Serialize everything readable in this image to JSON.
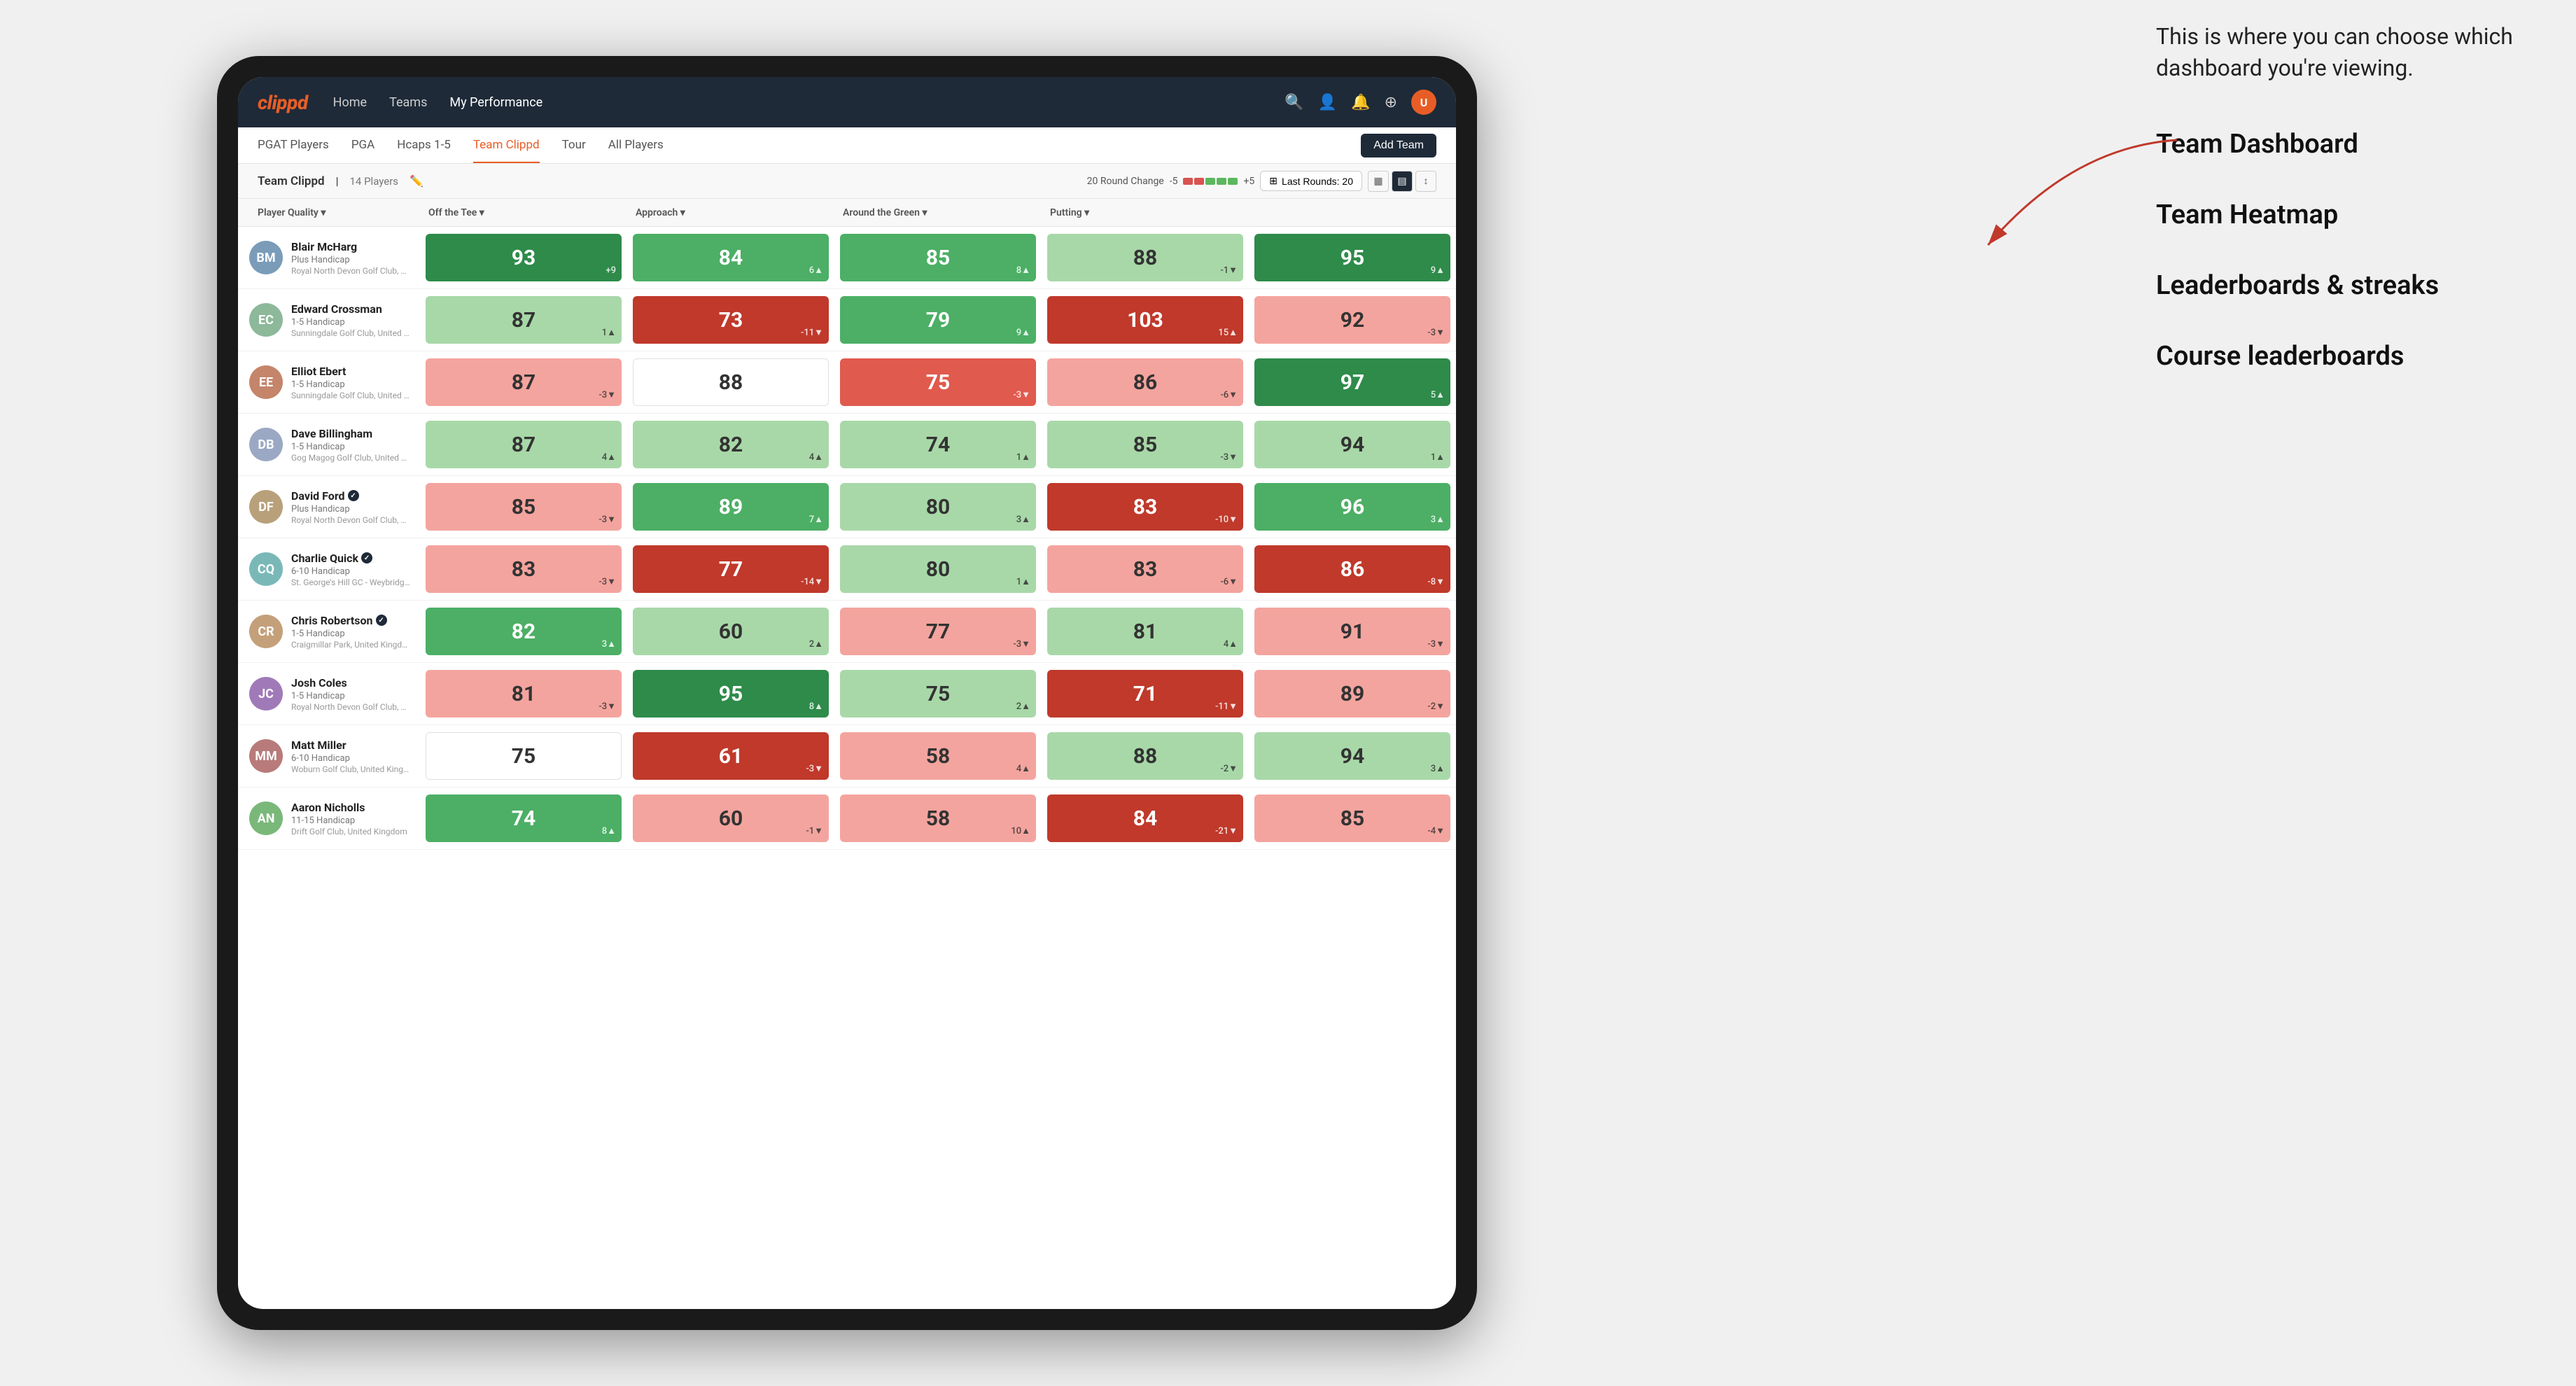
{
  "annotation": {
    "description": "This is where you can choose which dashboard you're viewing.",
    "labels": [
      "Team Dashboard",
      "Team Heatmap",
      "Leaderboards & streaks",
      "Course leaderboards"
    ]
  },
  "navbar": {
    "logo": "clippd",
    "links": [
      {
        "label": "Home",
        "active": false
      },
      {
        "label": "Teams",
        "active": false
      },
      {
        "label": "My Performance",
        "active": true
      }
    ],
    "icons": [
      "🔍",
      "👤",
      "🔔",
      "⊕"
    ]
  },
  "subnav": {
    "tabs": [
      {
        "label": "PGAT Players",
        "active": false
      },
      {
        "label": "PGA",
        "active": false
      },
      {
        "label": "Hcaps 1-5",
        "active": false
      },
      {
        "label": "Team Clippd",
        "active": true
      },
      {
        "label": "Tour",
        "active": false
      },
      {
        "label": "All Players",
        "active": false
      }
    ],
    "add_team_label": "Add Team"
  },
  "team_header": {
    "name": "Team Clippd",
    "separator": "|",
    "player_count": "14 Players",
    "round_change_label": "20 Round Change",
    "round_change_min": "-5",
    "round_change_max": "+5",
    "last_rounds_label": "Last Rounds:",
    "last_rounds_value": "20"
  },
  "table": {
    "columns": [
      {
        "label": "Player Quality ▾",
        "key": "player_quality"
      },
      {
        "label": "Off the Tee ▾",
        "key": "off_the_tee"
      },
      {
        "label": "Approach ▾",
        "key": "approach"
      },
      {
        "label": "Around the Green ▾",
        "key": "around_the_green"
      },
      {
        "label": "Putting ▾",
        "key": "putting"
      }
    ],
    "players": [
      {
        "name": "Blair McHarg",
        "handicap": "Plus Handicap",
        "club": "Royal North Devon Golf Club, United Kingdom",
        "avatar_initials": "BM",
        "avatar_color": "#7a9cb8",
        "verified": false,
        "scores": [
          {
            "value": 93,
            "delta": "+9",
            "trend": "up",
            "color": "green-strong"
          },
          {
            "value": 84,
            "delta": "6▲",
            "trend": "up",
            "color": "green-mid"
          },
          {
            "value": 85,
            "delta": "8▲",
            "trend": "up",
            "color": "green-mid"
          },
          {
            "value": 88,
            "delta": "-1▼",
            "trend": "down",
            "color": "green-light"
          },
          {
            "value": 95,
            "delta": "9▲",
            "trend": "up",
            "color": "green-strong"
          }
        ]
      },
      {
        "name": "Edward Crossman",
        "handicap": "1-5 Handicap",
        "club": "Sunningdale Golf Club, United Kingdom",
        "avatar_initials": "EC",
        "avatar_color": "#8db89a",
        "verified": false,
        "scores": [
          {
            "value": 87,
            "delta": "1▲",
            "trend": "up",
            "color": "green-light"
          },
          {
            "value": 73,
            "delta": "-11▼",
            "trend": "down",
            "color": "red-strong"
          },
          {
            "value": 79,
            "delta": "9▲",
            "trend": "up",
            "color": "green-mid"
          },
          {
            "value": 103,
            "delta": "15▲",
            "trend": "up",
            "color": "red-strong"
          },
          {
            "value": 92,
            "delta": "-3▼",
            "trend": "down",
            "color": "red-light"
          }
        ]
      },
      {
        "name": "Elliot Ebert",
        "handicap": "1-5 Handicap",
        "club": "Sunningdale Golf Club, United Kingdom",
        "avatar_initials": "EE",
        "avatar_color": "#c4856a",
        "verified": false,
        "scores": [
          {
            "value": 87,
            "delta": "-3▼",
            "trend": "down",
            "color": "red-light"
          },
          {
            "value": 88,
            "delta": "",
            "trend": "neutral",
            "color": "white"
          },
          {
            "value": 75,
            "delta": "-3▼",
            "trend": "down",
            "color": "red-mid"
          },
          {
            "value": 86,
            "delta": "-6▼",
            "trend": "down",
            "color": "red-light"
          },
          {
            "value": 97,
            "delta": "5▲",
            "trend": "up",
            "color": "green-strong"
          }
        ]
      },
      {
        "name": "Dave Billingham",
        "handicap": "1-5 Handicap",
        "club": "Gog Magog Golf Club, United Kingdom",
        "avatar_initials": "DB",
        "avatar_color": "#9ba8c4",
        "verified": false,
        "scores": [
          {
            "value": 87,
            "delta": "4▲",
            "trend": "up",
            "color": "green-light"
          },
          {
            "value": 82,
            "delta": "4▲",
            "trend": "up",
            "color": "green-light"
          },
          {
            "value": 74,
            "delta": "1▲",
            "trend": "up",
            "color": "green-light"
          },
          {
            "value": 85,
            "delta": "-3▼",
            "trend": "down",
            "color": "green-light"
          },
          {
            "value": 94,
            "delta": "1▲",
            "trend": "up",
            "color": "green-light"
          }
        ]
      },
      {
        "name": "David Ford",
        "handicap": "Plus Handicap",
        "club": "Royal North Devon Golf Club, United Kingdom",
        "avatar_initials": "DF",
        "avatar_color": "#b8a07a",
        "verified": true,
        "scores": [
          {
            "value": 85,
            "delta": "-3▼",
            "trend": "down",
            "color": "red-light"
          },
          {
            "value": 89,
            "delta": "7▲",
            "trend": "up",
            "color": "green-mid"
          },
          {
            "value": 80,
            "delta": "3▲",
            "trend": "up",
            "color": "green-light"
          },
          {
            "value": 83,
            "delta": "-10▼",
            "trend": "down",
            "color": "red-strong"
          },
          {
            "value": 96,
            "delta": "3▲",
            "trend": "up",
            "color": "green-mid"
          }
        ]
      },
      {
        "name": "Charlie Quick",
        "handicap": "6-10 Handicap",
        "club": "St. George's Hill GC - Weybridge - Surrey, Uni...",
        "avatar_initials": "CQ",
        "avatar_color": "#7ab8b8",
        "verified": true,
        "scores": [
          {
            "value": 83,
            "delta": "-3▼",
            "trend": "down",
            "color": "red-light"
          },
          {
            "value": 77,
            "delta": "-14▼",
            "trend": "down",
            "color": "red-strong"
          },
          {
            "value": 80,
            "delta": "1▲",
            "trend": "up",
            "color": "green-light"
          },
          {
            "value": 83,
            "delta": "-6▼",
            "trend": "down",
            "color": "red-light"
          },
          {
            "value": 86,
            "delta": "-8▼",
            "trend": "down",
            "color": "red-strong"
          }
        ]
      },
      {
        "name": "Chris Robertson",
        "handicap": "1-5 Handicap",
        "club": "Craigmillar Park, United Kingdom",
        "avatar_initials": "CR",
        "avatar_color": "#c4a07a",
        "verified": true,
        "scores": [
          {
            "value": 82,
            "delta": "3▲",
            "trend": "up",
            "color": "green-mid"
          },
          {
            "value": 60,
            "delta": "2▲",
            "trend": "up",
            "color": "green-light"
          },
          {
            "value": 77,
            "delta": "-3▼",
            "trend": "down",
            "color": "red-light"
          },
          {
            "value": 81,
            "delta": "4▲",
            "trend": "up",
            "color": "green-light"
          },
          {
            "value": 91,
            "delta": "-3▼",
            "trend": "down",
            "color": "red-light"
          }
        ]
      },
      {
        "name": "Josh Coles",
        "handicap": "1-5 Handicap",
        "club": "Royal North Devon Golf Club, United Kingdom",
        "avatar_initials": "JC",
        "avatar_color": "#a07ab8",
        "verified": false,
        "scores": [
          {
            "value": 81,
            "delta": "-3▼",
            "trend": "down",
            "color": "red-light"
          },
          {
            "value": 95,
            "delta": "8▲",
            "trend": "up",
            "color": "green-strong"
          },
          {
            "value": 75,
            "delta": "2▲",
            "trend": "up",
            "color": "green-light"
          },
          {
            "value": 71,
            "delta": "-11▼",
            "trend": "down",
            "color": "red-strong"
          },
          {
            "value": 89,
            "delta": "-2▼",
            "trend": "down",
            "color": "red-light"
          }
        ]
      },
      {
        "name": "Matt Miller",
        "handicap": "6-10 Handicap",
        "club": "Woburn Golf Club, United Kingdom",
        "avatar_initials": "MM",
        "avatar_color": "#b87a7a",
        "verified": false,
        "scores": [
          {
            "value": 75,
            "delta": "",
            "trend": "neutral",
            "color": "white"
          },
          {
            "value": 61,
            "delta": "-3▼",
            "trend": "down",
            "color": "red-strong"
          },
          {
            "value": 58,
            "delta": "4▲",
            "trend": "up",
            "color": "red-light"
          },
          {
            "value": 88,
            "delta": "-2▼",
            "trend": "down",
            "color": "green-light"
          },
          {
            "value": 94,
            "delta": "3▲",
            "trend": "up",
            "color": "green-light"
          }
        ]
      },
      {
        "name": "Aaron Nicholls",
        "handicap": "11-15 Handicap",
        "club": "Drift Golf Club, United Kingdom",
        "avatar_initials": "AN",
        "avatar_color": "#7ab87a",
        "verified": false,
        "scores": [
          {
            "value": 74,
            "delta": "8▲",
            "trend": "up",
            "color": "green-mid"
          },
          {
            "value": 60,
            "delta": "-1▼",
            "trend": "down",
            "color": "red-light"
          },
          {
            "value": 58,
            "delta": "10▲",
            "trend": "up",
            "color": "red-light"
          },
          {
            "value": 84,
            "delta": "-21▼",
            "trend": "down",
            "color": "red-strong"
          },
          {
            "value": 85,
            "delta": "-4▼",
            "trend": "down",
            "color": "red-light"
          }
        ]
      }
    ]
  }
}
